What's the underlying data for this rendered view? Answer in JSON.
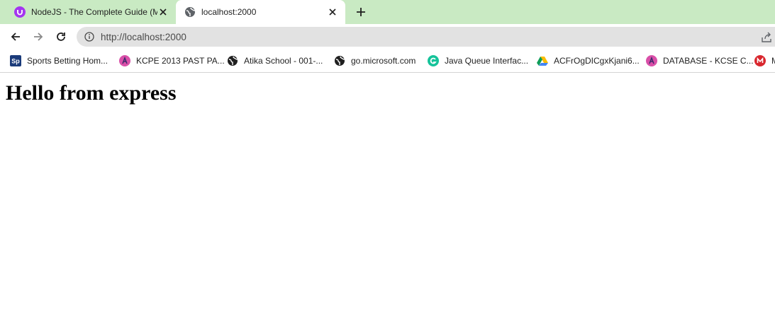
{
  "tabs": [
    {
      "title": "NodeJS - The Complete Guide (M",
      "icon": "udemy-icon",
      "active": false
    },
    {
      "title": "localhost:2000",
      "icon": "globe-icon",
      "active": true
    }
  ],
  "toolbar": {
    "url": "http://localhost:2000"
  },
  "bookmarks": [
    {
      "label": "Sports Betting Hom...",
      "icon": "sportpesa-icon",
      "icon_text": "Sp"
    },
    {
      "label": "KCPE 2013 PAST PA...",
      "icon": "atika-icon"
    },
    {
      "label": "Atika School - 001-...",
      "icon": "globe-icon"
    },
    {
      "label": "go.microsoft.com",
      "icon": "globe-icon"
    },
    {
      "label": "Java Queue Interfac...",
      "icon": "grammarly-icon"
    },
    {
      "label": "ACFrOgDICgxKjani6...",
      "icon": "google-drive-icon"
    },
    {
      "label": "DATABASE - KCSE C...",
      "icon": "atika-icon"
    },
    {
      "label": "M",
      "icon": "mega-icon"
    }
  ],
  "page": {
    "heading": "Hello from express"
  },
  "colors": {
    "tabstrip": "#c9eac3",
    "omnibox": "#e2e2e2",
    "udemy": "#a435f0",
    "atika": "#d94fa8"
  }
}
